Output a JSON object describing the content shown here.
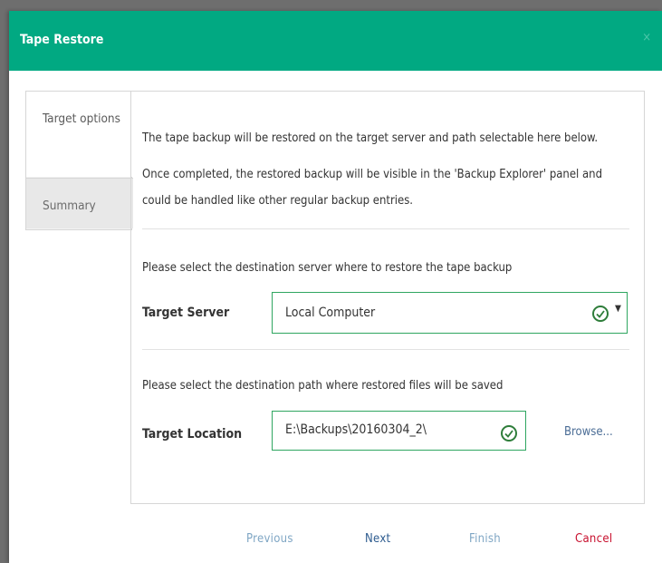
{
  "dialog": {
    "title": "Tape Restore",
    "close_label": "×"
  },
  "steps": [
    {
      "label": "Target options",
      "active": true
    },
    {
      "label": "Summary",
      "active": false
    }
  ],
  "content": {
    "intro_line1": "The tape backup will be restored on the target server and path selectable here below.",
    "intro_line2": "Once completed, the restored backup will be visible in the 'Backup Explorer' panel and",
    "intro_line3": "could be handled like other regular backup entries.",
    "server_prompt": "Please select the destination server where to restore the tape backup",
    "server_label": "Target Server",
    "server_value": "Local Computer",
    "path_prompt": "Please select the destination path where restored files will be saved",
    "location_label": "Target Location",
    "location_value": "E:\\Backups\\20160304_2\\",
    "browse_label": "Browse..."
  },
  "footer": {
    "previous": "Previous",
    "next": "Next",
    "finish": "Finish",
    "cancel": "Cancel"
  },
  "colors": {
    "header": "#01a982",
    "valid_border": "#2fa660",
    "cancel": "#c8102e",
    "disabled_btn": "#7fa6c4",
    "next": "#2d5b8f"
  }
}
